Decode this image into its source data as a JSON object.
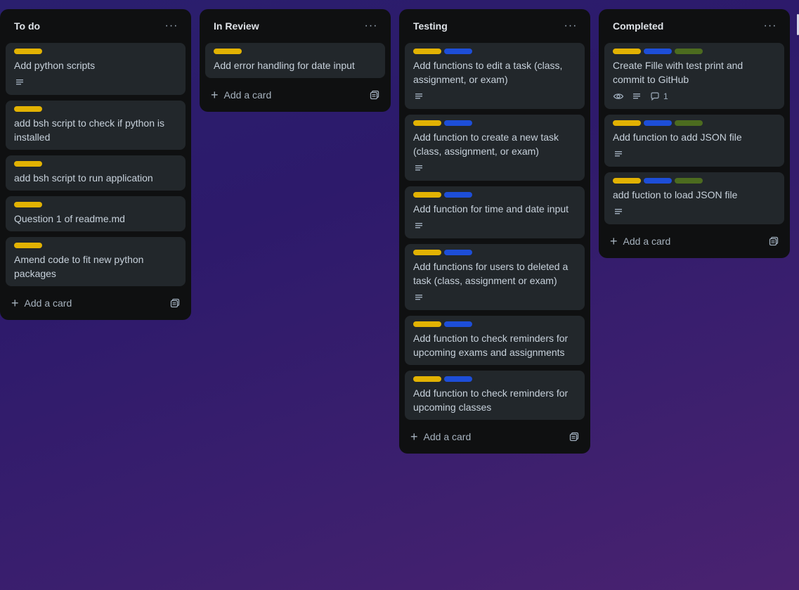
{
  "colors": {
    "yellow": "#e2b203",
    "blue": "#1d4ed8",
    "green": "#4c6b1f"
  },
  "lists": [
    {
      "title": "To do",
      "menu": "···",
      "add_card": "Add a card",
      "cards": [
        {
          "labels": [
            "yellow"
          ],
          "title": "Add python scripts",
          "description": true
        },
        {
          "labels": [
            "yellow"
          ],
          "title": "add bsh script to check if python is installed",
          "description": false
        },
        {
          "labels": [
            "yellow"
          ],
          "title": "add bsh script to run application",
          "description": false
        },
        {
          "labels": [
            "yellow"
          ],
          "title": "Question 1 of readme.md",
          "description": false
        },
        {
          "labels": [
            "yellow"
          ],
          "title": "Amend code to fit new python packages",
          "description": false
        }
      ]
    },
    {
      "title": "In Review",
      "menu": "···",
      "add_card": "Add a card",
      "cards": [
        {
          "labels": [
            "yellow"
          ],
          "title": "Add error handling for date input",
          "description": false
        }
      ]
    },
    {
      "title": "Testing",
      "menu": "···",
      "add_card": "Add a card",
      "cards": [
        {
          "labels": [
            "yellow",
            "blue"
          ],
          "title": "Add functions to edit a task (class, assignment, or exam)",
          "description": true
        },
        {
          "labels": [
            "yellow",
            "blue"
          ],
          "title": "Add function to create a new task (class, assignment, or exam)",
          "description": true
        },
        {
          "labels": [
            "yellow",
            "blue"
          ],
          "title": "Add function for time and date input",
          "description": true
        },
        {
          "labels": [
            "yellow",
            "blue"
          ],
          "title": "Add functions for users to deleted a task (class, assignment or exam)",
          "description": true
        },
        {
          "labels": [
            "yellow",
            "blue"
          ],
          "title": "Add function to check reminders for upcoming exams and assignments",
          "description": false
        },
        {
          "labels": [
            "yellow",
            "blue"
          ],
          "title": "Add function to check reminders for upcoming classes",
          "description": false
        }
      ]
    },
    {
      "title": "Completed",
      "menu": "···",
      "add_card": "Add a card",
      "cards": [
        {
          "labels": [
            "yellow",
            "blue",
            "green"
          ],
          "title": "Create Fille with test print and commit to GitHub",
          "description": true,
          "watching": true,
          "comments": "1"
        },
        {
          "labels": [
            "yellow",
            "blue",
            "green"
          ],
          "title": "Add function to add JSON file",
          "description": true
        },
        {
          "labels": [
            "yellow",
            "blue",
            "green"
          ],
          "title": "add fuction to load JSON file",
          "description": true
        }
      ]
    }
  ]
}
